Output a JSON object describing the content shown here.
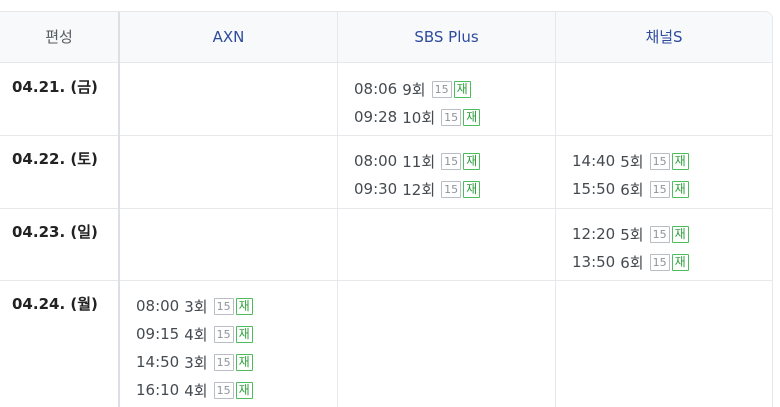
{
  "header": {
    "label": "편성",
    "channels": [
      "AXN",
      "SBS Plus",
      "채널S"
    ]
  },
  "rows": [
    {
      "date": "04.21. (금)",
      "cells": [
        [],
        [
          {
            "time": "08:06",
            "episode": "9회",
            "rating": "15",
            "tag": "재"
          },
          {
            "time": "09:28",
            "episode": "10회",
            "rating": "15",
            "tag": "재"
          }
        ],
        []
      ]
    },
    {
      "date": "04.22. (토)",
      "cells": [
        [],
        [
          {
            "time": "08:00",
            "episode": "11회",
            "rating": "15",
            "tag": "재"
          },
          {
            "time": "09:30",
            "episode": "12회",
            "rating": "15",
            "tag": "재"
          }
        ],
        [
          {
            "time": "14:40",
            "episode": "5회",
            "rating": "15",
            "tag": "재"
          },
          {
            "time": "15:50",
            "episode": "6회",
            "rating": "15",
            "tag": "재"
          }
        ]
      ]
    },
    {
      "date": "04.23. (일)",
      "cells": [
        [],
        [],
        [
          {
            "time": "12:20",
            "episode": "5회",
            "rating": "15",
            "tag": "재"
          },
          {
            "time": "13:50",
            "episode": "6회",
            "rating": "15",
            "tag": "재"
          }
        ]
      ]
    },
    {
      "date": "04.24. (월)",
      "cells": [
        [
          {
            "time": "08:00",
            "episode": "3회",
            "rating": "15",
            "tag": "재"
          },
          {
            "time": "09:15",
            "episode": "4회",
            "rating": "15",
            "tag": "재"
          },
          {
            "time": "14:50",
            "episode": "3회",
            "rating": "15",
            "tag": "재"
          },
          {
            "time": "16:10",
            "episode": "4회",
            "rating": "15",
            "tag": "재"
          }
        ],
        [],
        []
      ]
    }
  ],
  "colors": {
    "channel_text": "#2e4c9e",
    "rerun_badge": "#2e9e3c",
    "rating_badge": "#8e949a",
    "header_bg": "#f8f9fa"
  }
}
